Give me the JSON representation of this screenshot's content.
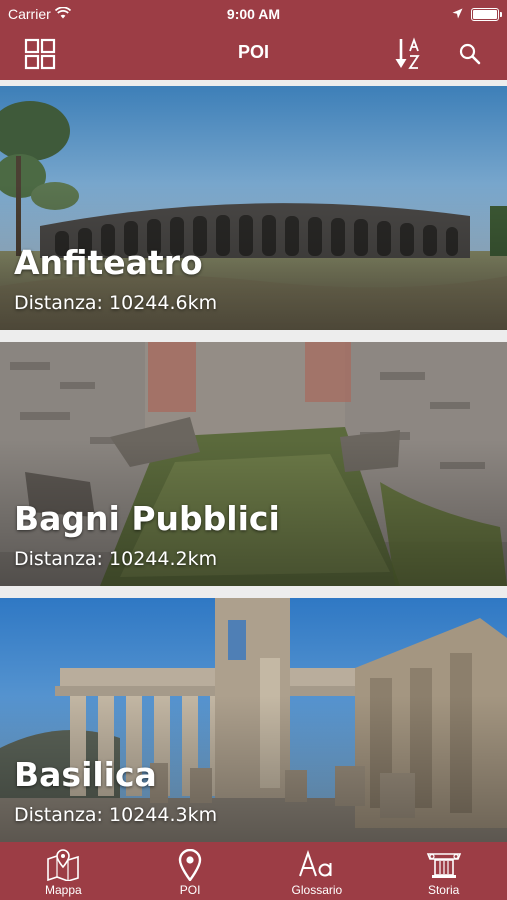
{
  "status_bar": {
    "carrier": "Carrier",
    "time": "9:00 AM"
  },
  "nav": {
    "title": "POI",
    "left_icon": "grid-icon",
    "sort_icon": "sort-az-icon",
    "search_icon": "search-icon"
  },
  "poi_list": [
    {
      "name": "Anfiteatro",
      "distance_label": "Distanza:",
      "distance_value": "10244.6km"
    },
    {
      "name": "Bagni Pubblici",
      "distance_label": "Distanza:",
      "distance_value": "10244.2km"
    },
    {
      "name": "Basilica",
      "distance_label": "Distanza:",
      "distance_value": "10244.3km"
    }
  ],
  "tabs": [
    {
      "label": "Mappa",
      "icon": "map-icon"
    },
    {
      "label": "POI",
      "icon": "location-pin-icon"
    },
    {
      "label": "Glossario",
      "icon": "glossary-icon"
    },
    {
      "label": "Storia",
      "icon": "column-icon"
    }
  ],
  "colors": {
    "brand": "#9c3d45",
    "background": "#ededed"
  }
}
